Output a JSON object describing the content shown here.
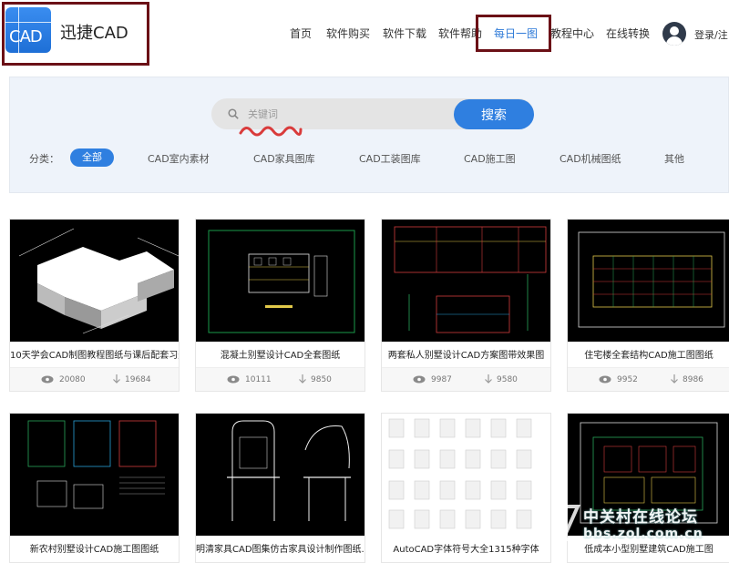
{
  "brand": {
    "logo_text": "CAD",
    "name": "迅捷CAD"
  },
  "nav": {
    "items": [
      "首页",
      "软件购买",
      "软件下载",
      "软件帮助",
      "每日一图",
      "教程中心",
      "在线转换"
    ],
    "active": "每日一图",
    "login": "登录/注"
  },
  "search": {
    "placeholder": "关键词",
    "button": "搜索"
  },
  "categories": {
    "label": "分类：",
    "items": [
      "全部",
      "CAD室内素材",
      "CAD家具图库",
      "CAD工装图库",
      "CAD施工图",
      "CAD机械图纸",
      "其他"
    ],
    "active": "全部"
  },
  "cards": [
    {
      "title": "10天学会CAD制图教程图纸与课后配套习题",
      "views": "20080",
      "downloads": "19684",
      "icon": "isometric-block"
    },
    {
      "title": "混凝土别墅设计CAD全套图纸",
      "views": "10111",
      "downloads": "9850",
      "icon": "villa-elevation"
    },
    {
      "title": "两套私人别墅设计CAD方案图带效果图",
      "views": "9987",
      "downloads": "9580",
      "icon": "villa-section"
    },
    {
      "title": "住宅楼全套结构CAD施工图图纸",
      "views": "9952",
      "downloads": "8986",
      "icon": "structure-grid"
    },
    {
      "title": "新农村别墅设计CAD施工图图纸",
      "icon": "rural-villa-sheet"
    },
    {
      "title": "明清家具CAD图集仿古家具设计制作图纸...",
      "icon": "antique-chair"
    },
    {
      "title": "AutoCAD字体符号大全1315种字体",
      "icon": "font-files"
    },
    {
      "title": "低成本小型别墅建筑CAD施工图",
      "icon": "floor-plan"
    }
  ],
  "watermark": {
    "text": "中关村在线论坛",
    "url": "bbs.zol.com.cn"
  },
  "colors": {
    "accent": "#2f7fe0",
    "annotation": "#6b1016",
    "panel": "#eef3fa"
  }
}
